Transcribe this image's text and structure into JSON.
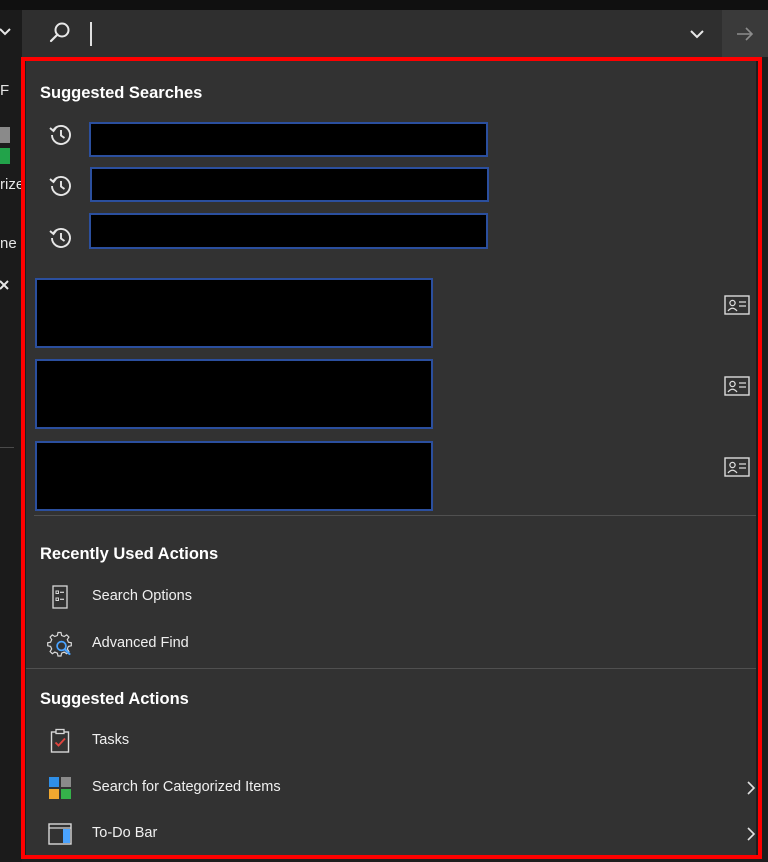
{
  "left_panel": {
    "texts": [
      "F",
      "rize",
      "ne"
    ]
  },
  "search": {
    "value": ""
  },
  "suggested_searches": {
    "heading": "Suggested Searches",
    "items": [
      "",
      "",
      ""
    ]
  },
  "recent_actions": {
    "heading": "Recently Used Actions",
    "items": [
      {
        "label": "Search Options",
        "icon": "search-options-icon"
      },
      {
        "label": "Advanced Find",
        "icon": "advanced-find-icon"
      }
    ]
  },
  "suggested_actions": {
    "heading": "Suggested Actions",
    "items": [
      {
        "label": "Tasks",
        "icon": "tasks-icon"
      },
      {
        "label": "Search for Categorized Items",
        "icon": "categorize-icon"
      },
      {
        "label": "To-Do Bar",
        "icon": "todo-bar-icon"
      }
    ]
  },
  "colors": {
    "panel_bg": "#323232",
    "searchbar_bg": "#2f2f2f",
    "highlight_outline": "#ff0000",
    "redaction_border": "#2b4f9e"
  }
}
